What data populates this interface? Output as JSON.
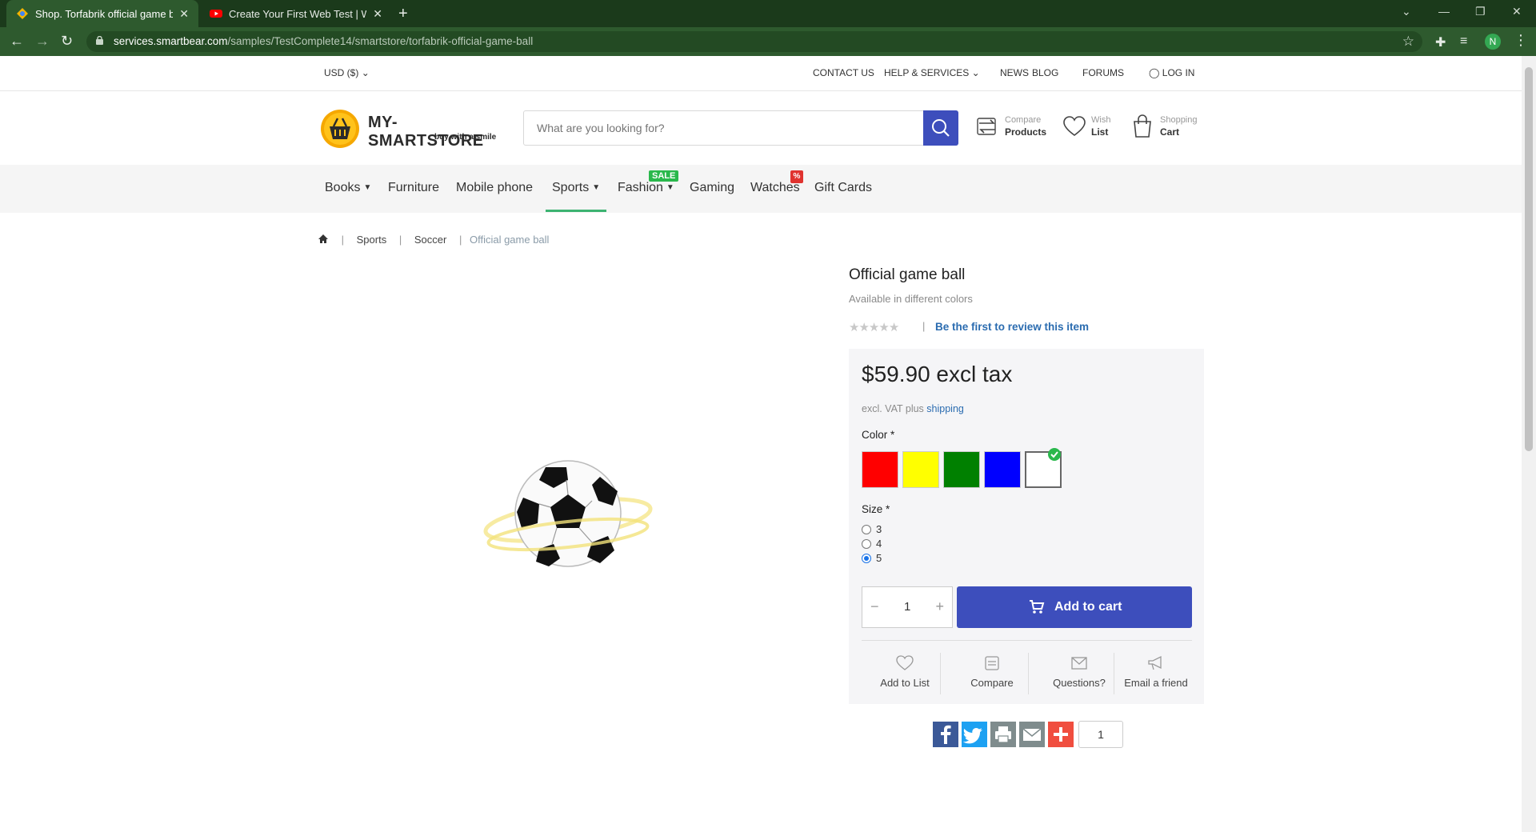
{
  "browser": {
    "tabs": [
      {
        "title": "Shop. Torfabrik official game ball",
        "active": true
      },
      {
        "title": "Create Your First Web Test | Web",
        "active": false
      }
    ],
    "url_host": "services.smartbear.com",
    "url_path": "/samples/TestComplete14/smartstore/torfabrik-official-game-ball",
    "profile_initial": "N"
  },
  "topbar": {
    "currency": "USD  ($)",
    "links": {
      "contact": "CONTACT US",
      "help": "HELP & SERVICES",
      "news": "NEWS",
      "blog": "BLOG",
      "forums": "FORUMS",
      "login": "LOG IN"
    }
  },
  "header": {
    "logo_text": "MY-SMARTSTORE",
    "logo_tagline": "buy with a smile",
    "search_placeholder": "What are you looking for?",
    "compare": {
      "line1": "Compare",
      "line2": "Products"
    },
    "wishlist": {
      "line1": "Wish",
      "line2": "List"
    },
    "cart": {
      "line1": "Shopping",
      "line2": "Cart"
    }
  },
  "nav": {
    "items": [
      "Books",
      "Furniture",
      "Mobile phone",
      "Sports",
      "Fashion",
      "Gaming",
      "Watches",
      "Gift Cards"
    ],
    "active": "Sports",
    "sale_badge": "SALE",
    "pct_badge": "%"
  },
  "breadcrumb": {
    "sports": "Sports",
    "soccer": "Soccer",
    "current": "Official game ball"
  },
  "product": {
    "title": "Official game ball",
    "subtitle": "Available in different colors",
    "rating_stars": 0,
    "review_link": "Be the first to review this item",
    "price": "$59.90 excl tax",
    "tax_note": "excl. VAT plus",
    "shipping_link": "shipping",
    "color_label": "Color *",
    "colors": [
      "#ff0000",
      "#ffff00",
      "#008000",
      "#0000ff",
      "#ffffff"
    ],
    "selected_color_index": 4,
    "size_label": "Size *",
    "sizes": [
      "3",
      "4",
      "5"
    ],
    "selected_size": "5",
    "quantity": "1",
    "add_to_cart": "Add to cart",
    "actions": {
      "add_to_list": "Add to List",
      "compare": "Compare",
      "questions": "Questions?",
      "email_friend": "Email a friend"
    }
  },
  "share": {
    "count": "1",
    "colors": {
      "facebook": "#3b5998",
      "twitter": "#1da1f2",
      "print": "#7f8c8d",
      "email": "#7f8c8d",
      "more": "#f04e3f"
    }
  },
  "theme": {
    "accent": "#3d4ebc",
    "link": "#2b6cb0",
    "nav_active": "#3cb371",
    "browser_green": "#2e5a2e"
  }
}
